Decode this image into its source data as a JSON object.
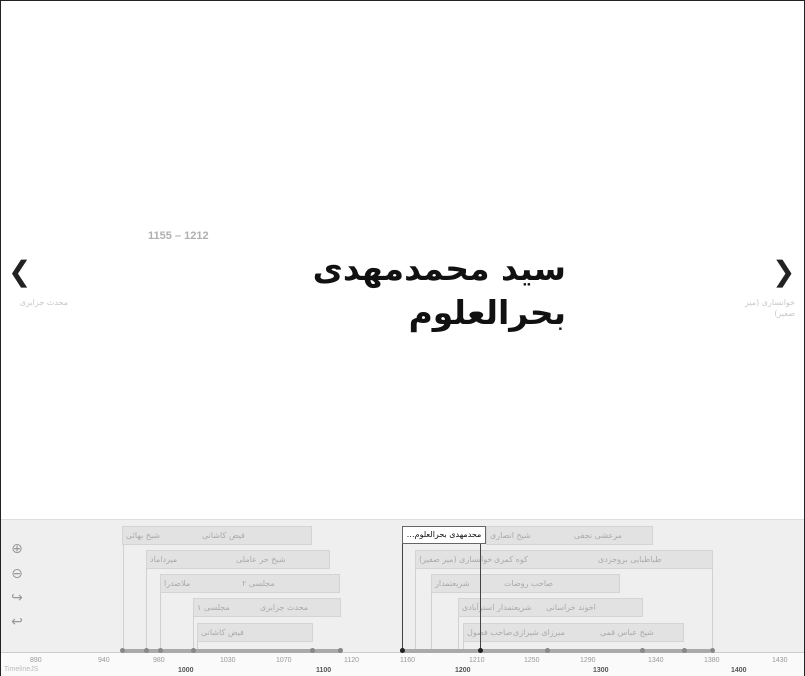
{
  "slide": {
    "date": "1155 – 1212",
    "headline": "سید محمدمهدی بحرالعلوم",
    "prev_label": "محدث جزایری",
    "next_label": "خوانساری (میر صفیر)"
  },
  "nav": {
    "prev_icon": "❮",
    "next_icon": "❯"
  },
  "timenav": {
    "zoom_in": "⊕",
    "zoom_out": "⊖",
    "back": "↪",
    "undo": "↩",
    "active_item": "محدمهدی بحرالعلوم…",
    "items_left": [
      {
        "a": "شیخ بهائی",
        "b": "فیض کاشانی"
      },
      {
        "a": "میرداماد",
        "b": "شیخ حر عاملی"
      },
      {
        "a": "ملاصدرا",
        "b": "مجلسی ۲"
      },
      {
        "a": "مجلسی ۱",
        "b": "محدث جزایری"
      },
      {
        "a": "فیض کاشانی",
        "b": ""
      }
    ],
    "items_right": [
      {
        "a": "شیخ انصاری",
        "b": "مرعشی نجفی"
      },
      {
        "a": "خوانساری (میر صفیر)",
        "b": "کوه کمری",
        "c": "طباطبایی بروجردی"
      },
      {
        "a": "شریعتمدار",
        "b": "صاحب روضات"
      },
      {
        "a": "شریعتمدار استرآبادی",
        "b": "اخوند خراسانی"
      },
      {
        "a": "صاحب فصول",
        "b": "میرزای شیرازی",
        "c": "شیخ عباس قمی"
      }
    ],
    "ticks": [
      "890",
      "940",
      "980",
      "1030",
      "1070",
      "1120",
      "1160",
      "1210",
      "1250",
      "1290",
      "1340",
      "1380",
      "1430"
    ],
    "major_ticks": [
      "1000",
      "1100",
      "1200",
      "1300",
      "1400"
    ],
    "brand": "TimelineJS"
  }
}
